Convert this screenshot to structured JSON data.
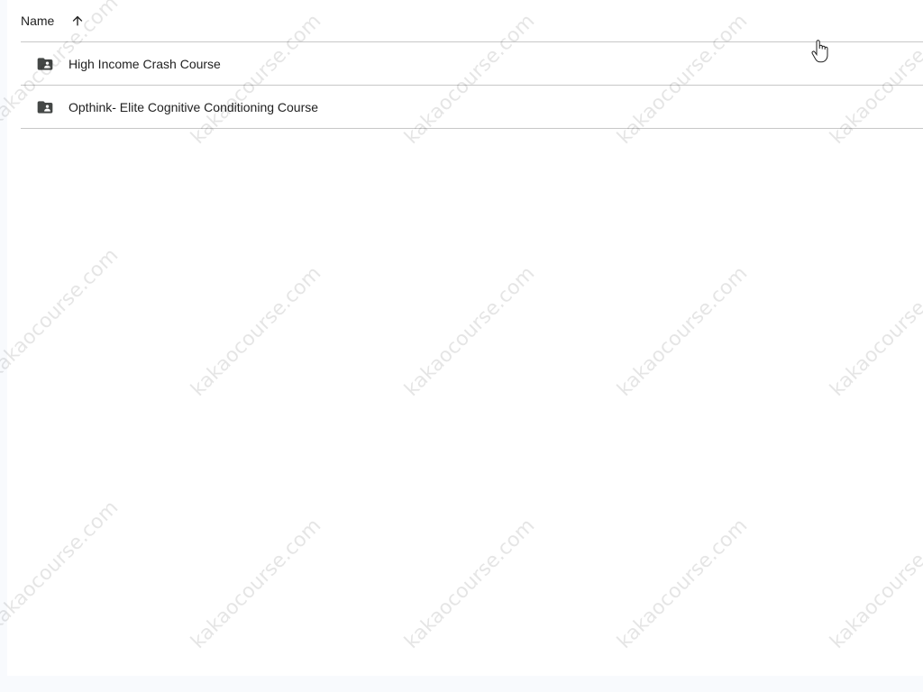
{
  "header": {
    "name_label": "Name",
    "sort_icon": "arrow-upward-icon"
  },
  "items": [
    {
      "label": "High Income Crash Course",
      "icon": "shared-folder-icon"
    },
    {
      "label": "Opthink- Elite Cognitive Conditioning Course",
      "icon": "shared-folder-icon"
    }
  ],
  "watermark": "kakaocourse.com",
  "colors": {
    "text": "#1f1f1f",
    "divider": "#c7c7c7",
    "icon": "#444746"
  }
}
